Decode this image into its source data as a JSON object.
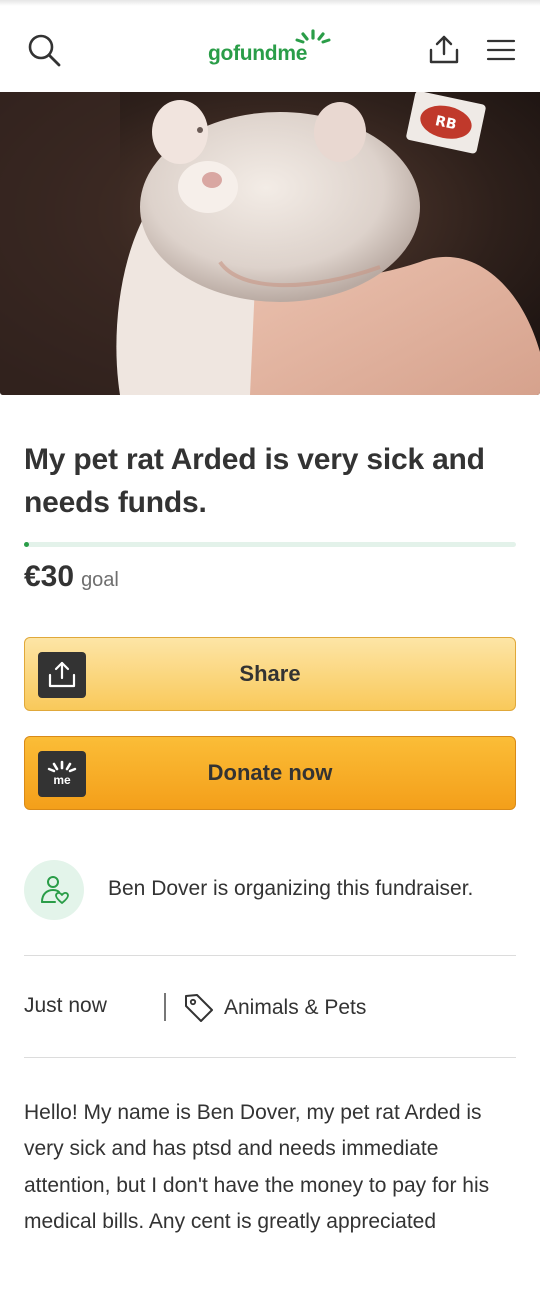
{
  "header": {
    "logo": {
      "go": "go",
      "fund": "fund",
      "me": "me"
    },
    "icons": {
      "search": "search-icon",
      "share": "share-icon",
      "menu": "menu-icon"
    }
  },
  "campaign": {
    "title": "My pet rat Arded is very sick and needs funds.",
    "progress_fraction": 0.01,
    "goal_amount": "€30",
    "goal_label": "goal"
  },
  "actions": {
    "share_label": "Share",
    "donate_label": "Donate now"
  },
  "organizer": {
    "text": "Ben Dover is organizing this fundraiser."
  },
  "meta": {
    "time": "Just now",
    "category": "Animals & Pets"
  },
  "story": {
    "text": "Hello! My name is Ben Dover, my pet rat Arded is very sick and has ptsd and needs immediate attention, but I don't have the money to pay for his medical bills. Any cent is greatly appreciated"
  },
  "colors": {
    "brand_green": "#2a9d48",
    "share_button": "#f9c95a",
    "donate_button": "#f49f1a",
    "text": "#333333"
  }
}
